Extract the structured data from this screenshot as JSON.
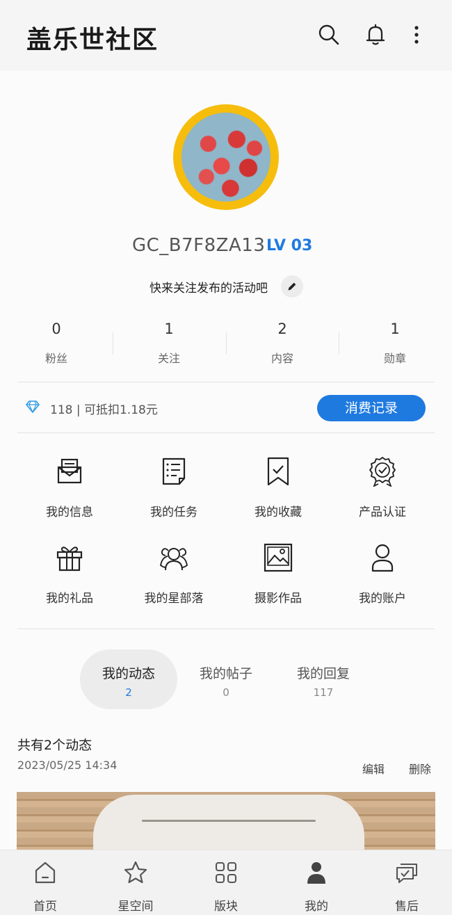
{
  "header": {
    "title": "盖乐世社区",
    "icons": [
      "search-icon",
      "bell-icon",
      "more-vertical-icon"
    ]
  },
  "profile": {
    "username": "GC_B7F8ZA13",
    "level": "LV 03",
    "bio": "快来关注发布的活动吧",
    "avatar": "strawberries-avatar"
  },
  "stats": [
    {
      "value": "0",
      "label": "粉丝"
    },
    {
      "value": "1",
      "label": "关注"
    },
    {
      "value": "2",
      "label": "内容"
    },
    {
      "value": "1",
      "label": "勋章"
    }
  ],
  "points": {
    "text": "118 | 可抵扣1.18元",
    "button": "消费记录"
  },
  "grid": [
    {
      "label": "我的信息",
      "icon": "mail-icon"
    },
    {
      "label": "我的任务",
      "icon": "task-list-icon"
    },
    {
      "label": "我的收藏",
      "icon": "bookmark-icon"
    },
    {
      "label": "产品认证",
      "icon": "badge-icon"
    },
    {
      "label": "我的礼品",
      "icon": "gift-icon"
    },
    {
      "label": "我的星部落",
      "icon": "group-icon"
    },
    {
      "label": "摄影作品",
      "icon": "image-icon"
    },
    {
      "label": "我的账户",
      "icon": "user-icon"
    }
  ],
  "tabs": [
    {
      "label": "我的动态",
      "count": "2",
      "active": true
    },
    {
      "label": "我的帖子",
      "count": "0",
      "active": false
    },
    {
      "label": "我的回复",
      "count": "117",
      "active": false
    }
  ],
  "feed": {
    "title": "共有2个动态",
    "date": "2023/05/25 14:34",
    "edit": "编辑",
    "delete": "删除"
  },
  "nav": [
    {
      "label": "首页",
      "icon": "home-icon"
    },
    {
      "label": "星空间",
      "icon": "star-icon"
    },
    {
      "label": "版块",
      "icon": "grid-icon"
    },
    {
      "label": "我的",
      "icon": "person-icon"
    },
    {
      "label": "售后",
      "icon": "chat-check-icon"
    }
  ],
  "colors": {
    "accent": "#1f7ae0",
    "avatar_ring": "#f6bd0d"
  }
}
